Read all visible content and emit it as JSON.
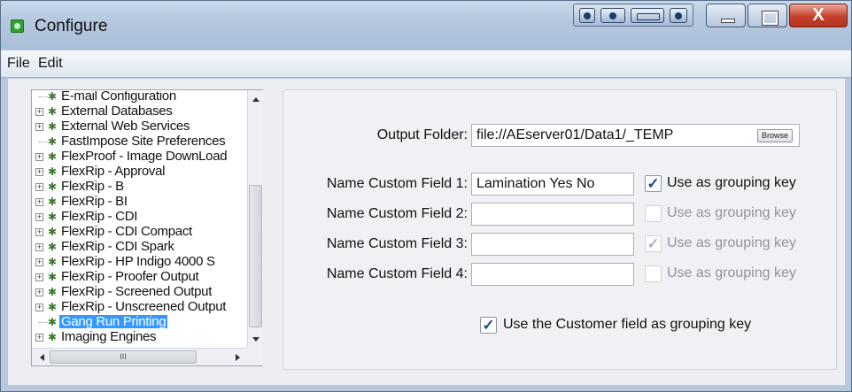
{
  "window": {
    "title": "Configure",
    "close_glyph": "X"
  },
  "menu": {
    "file": "File",
    "edit": "Edit"
  },
  "tree": {
    "items": [
      {
        "label": "E-mail Configuration",
        "expandable": false
      },
      {
        "label": "External Databases",
        "expandable": true
      },
      {
        "label": "External Web Services",
        "expandable": true
      },
      {
        "label": "FastImpose Site Preferences",
        "expandable": false
      },
      {
        "label": "FlexProof - Image DownLoad",
        "expandable": true
      },
      {
        "label": "FlexRip - Approval",
        "expandable": true
      },
      {
        "label": "FlexRip - B",
        "expandable": true
      },
      {
        "label": "FlexRip - BI",
        "expandable": true
      },
      {
        "label": "FlexRip - CDI",
        "expandable": true
      },
      {
        "label": "FlexRip - CDI Compact",
        "expandable": true
      },
      {
        "label": "FlexRip - CDI Spark",
        "expandable": true
      },
      {
        "label": "FlexRip - HP Indigo 4000 S",
        "expandable": true
      },
      {
        "label": "FlexRip - Proofer Output",
        "expandable": true
      },
      {
        "label": "FlexRip - Screened Output",
        "expandable": true
      },
      {
        "label": "FlexRip - Unscreened Output",
        "expandable": true
      },
      {
        "label": "Gang Run Printing",
        "expandable": false,
        "selected": true
      },
      {
        "label": "Imaging Engines",
        "expandable": true
      }
    ],
    "hscroll_grip": "III"
  },
  "settings": {
    "output_folder": {
      "label": "Output Folder:",
      "value": "file://AEserver01/Data1/_TEMP",
      "browse": "Browse"
    },
    "custom_fields": [
      {
        "label": "Name Custom Field 1:",
        "value": "Lamination Yes No",
        "grouping_label": "Use as grouping key",
        "checked": true,
        "enabled": true
      },
      {
        "label": "Name Custom Field 2:",
        "value": "",
        "grouping_label": "Use as grouping key",
        "checked": false,
        "enabled": false
      },
      {
        "label": "Name Custom Field 3:",
        "value": "",
        "grouping_label": "Use as grouping key",
        "checked": true,
        "enabled": false
      },
      {
        "label": "Name Custom Field 4:",
        "value": "",
        "grouping_label": "Use as grouping key",
        "checked": false,
        "enabled": false
      }
    ],
    "customer_grouping": {
      "label": "Use the Customer field as grouping key",
      "checked": true
    }
  }
}
